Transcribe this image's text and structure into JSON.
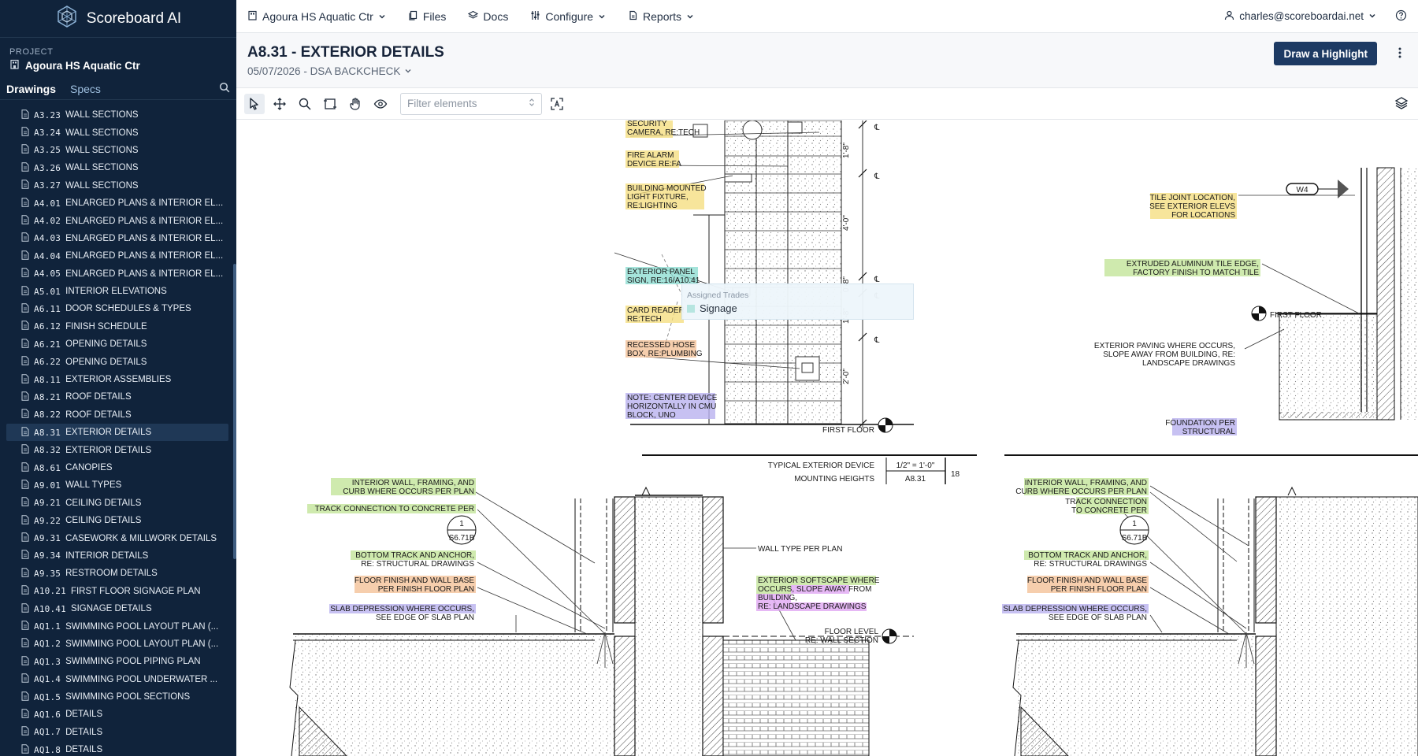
{
  "brand": {
    "name": "Scoreboard AI"
  },
  "project": {
    "label": "PROJECT",
    "name": "Agoura HS Aquatic Ctr"
  },
  "sidebar": {
    "tabs": [
      "Drawings",
      "Specs"
    ],
    "sheets": [
      {
        "num": "A3.23",
        "title": "WALL SECTIONS"
      },
      {
        "num": "A3.24",
        "title": "WALL SECTIONS"
      },
      {
        "num": "A3.25",
        "title": "WALL SECTIONS"
      },
      {
        "num": "A3.26",
        "title": "WALL SECTIONS"
      },
      {
        "num": "A3.27",
        "title": "WALL SECTIONS"
      },
      {
        "num": "A4.01",
        "title": "ENLARGED PLANS & INTERIOR EL..."
      },
      {
        "num": "A4.02",
        "title": "ENLARGED PLANS & INTERIOR EL..."
      },
      {
        "num": "A4.03",
        "title": "ENLARGED PLANS & INTERIOR EL..."
      },
      {
        "num": "A4.04",
        "title": "ENLARGED PLANS & INTERIOR EL..."
      },
      {
        "num": "A4.05",
        "title": "ENLARGED PLANS & INTERIOR EL..."
      },
      {
        "num": "A5.01",
        "title": "INTERIOR ELEVATIONS"
      },
      {
        "num": "A6.11",
        "title": "DOOR SCHEDULES & TYPES"
      },
      {
        "num": "A6.12",
        "title": "FINISH SCHEDULE"
      },
      {
        "num": "A6.21",
        "title": "OPENING DETAILS"
      },
      {
        "num": "A6.22",
        "title": "OPENING DETAILS"
      },
      {
        "num": "A8.11",
        "title": "EXTERIOR ASSEMBLIES"
      },
      {
        "num": "A8.21",
        "title": "ROOF DETAILS"
      },
      {
        "num": "A8.22",
        "title": "ROOF DETAILS"
      },
      {
        "num": "A8.31",
        "title": "EXTERIOR DETAILS",
        "active": true
      },
      {
        "num": "A8.32",
        "title": "EXTERIOR DETAILS"
      },
      {
        "num": "A8.61",
        "title": "CANOPIES"
      },
      {
        "num": "A9.01",
        "title": "WALL TYPES"
      },
      {
        "num": "A9.21",
        "title": "CEILING DETAILS"
      },
      {
        "num": "A9.22",
        "title": "CEILING DETAILS"
      },
      {
        "num": "A9.31",
        "title": "CASEWORK & MILLWORK DETAILS"
      },
      {
        "num": "A9.34",
        "title": "INTERIOR DETAILS"
      },
      {
        "num": "A9.35",
        "title": "RESTROOM DETAILS"
      },
      {
        "num": "A10.21",
        "title": "FIRST FLOOR SIGNAGE PLAN"
      },
      {
        "num": "A10.41",
        "title": "SIGNAGE DETAILS"
      },
      {
        "num": "AQ1.1",
        "title": "SWIMMING POOL LAYOUT PLAN (..."
      },
      {
        "num": "AQ1.2",
        "title": "SWIMMING POOL LAYOUT PLAN (..."
      },
      {
        "num": "AQ1.3",
        "title": "SWIMMING POOL PIPING PLAN"
      },
      {
        "num": "AQ1.4",
        "title": "SWIMMING POOL UNDERWATER ..."
      },
      {
        "num": "AQ1.5",
        "title": "SWIMMING POOL SECTIONS"
      },
      {
        "num": "AQ1.6",
        "title": "DETAILS"
      },
      {
        "num": "AQ1.7",
        "title": "DETAILS"
      },
      {
        "num": "AQ1.8",
        "title": "DETAILS"
      }
    ]
  },
  "topnav": {
    "project": "Agoura HS Aquatic Ctr",
    "files": "Files",
    "docs": "Docs",
    "configure": "Configure",
    "reports": "Reports",
    "user": "charles@scoreboardai.net"
  },
  "header": {
    "title": "A8.31 - EXTERIOR DETAILS",
    "subtitle": "05/07/2026 - DSA BACKCHECK",
    "draw_button": "Draw a Highlight"
  },
  "toolbar": {
    "filter_placeholder": "Filter elements"
  },
  "tooltip": {
    "title": "Assigned Trades",
    "item": "Signage"
  },
  "drawing": {
    "labels": {
      "security": [
        "SECURITY",
        "CAMERA, RE:TECH"
      ],
      "fire_alarm": [
        "FIRE ALARM",
        "DEVICE RE:FA"
      ],
      "light": [
        "BUILDING MOUNTED",
        "LIGHT FIXTURE,",
        "RE:LIGHTING"
      ],
      "panel": [
        "EXTERIOR PANEL",
        "SIGN, RE:16/A10.41"
      ],
      "card": [
        "CARD READER",
        "RE:TECH"
      ],
      "hose": [
        "RECESSED HOSE",
        "BOX, RE:PLUMBING"
      ],
      "note": [
        "NOTE: CENTER DEVICE",
        "HORIZONTALLY IN CMU",
        "BLOCK, UNO"
      ],
      "tile_joint": [
        "TILE JOINT LOCATION,",
        "SEE EXTERIOR ELEVS",
        "FOR LOCATIONS"
      ],
      "extruded": [
        "EXTRUDED ALUMINUM TILE EDGE,",
        "FACTORY FINISH TO MATCH TILE"
      ],
      "paving": [
        "EXTERIOR PAVING WHERE OCCURS,",
        "SLOPE AWAY FROM BUILDING, RE:",
        "LANDSCAPE DRAWINGS"
      ],
      "foundation": [
        "FOUNDATION PER",
        "STRUCTURAL"
      ],
      "first_floor": "FIRST FLOOR",
      "w4": "W4",
      "dims": [
        "1'-8\"",
        "4'-0\"",
        "0'-8\"",
        "1'-8\"",
        "2'-0\""
      ],
      "title_block": [
        "TYPICAL EXTERIOR DEVICE",
        "MOUNTING HEIGHTS"
      ],
      "scale": "1/2\" = 1'-0\"",
      "sheet_ref": "A8.31",
      "detail_num": "18",
      "interior_wall": [
        "INTERIOR WALL, FRAMING, AND",
        "CURB WHERE OCCURS PER PLAN"
      ],
      "track": "TRACK CONNECTION TO CONCRETE PER",
      "track_right": [
        "TRACK CONNECTION",
        "TO CONCRETE PER"
      ],
      "bubble": [
        "1",
        "S6.71B"
      ],
      "bottom_track": [
        "BOTTOM TRACK AND ANCHOR,",
        "RE: STRUCTURAL DRAWINGS"
      ],
      "floor_finish": [
        "FLOOR FINISH AND WALL BASE",
        "PER FINISH FLOOR PLAN"
      ],
      "slab": [
        "SLAB DEPRESSION WHERE OCCURS,",
        "SEE EDGE OF SLAB PLAN"
      ],
      "wall_type": "WALL TYPE PER PLAN",
      "softscape": [
        "EXTERIOR SOFTSCAPE WHERE",
        "OCCURS, SLOPE AWAY FROM",
        "BUILDING,",
        "RE: LANDSCAPE DRAWINGS"
      ],
      "floor_level": [
        "FLOOR LEVEL",
        "RE: WALL SECTION"
      ]
    }
  }
}
